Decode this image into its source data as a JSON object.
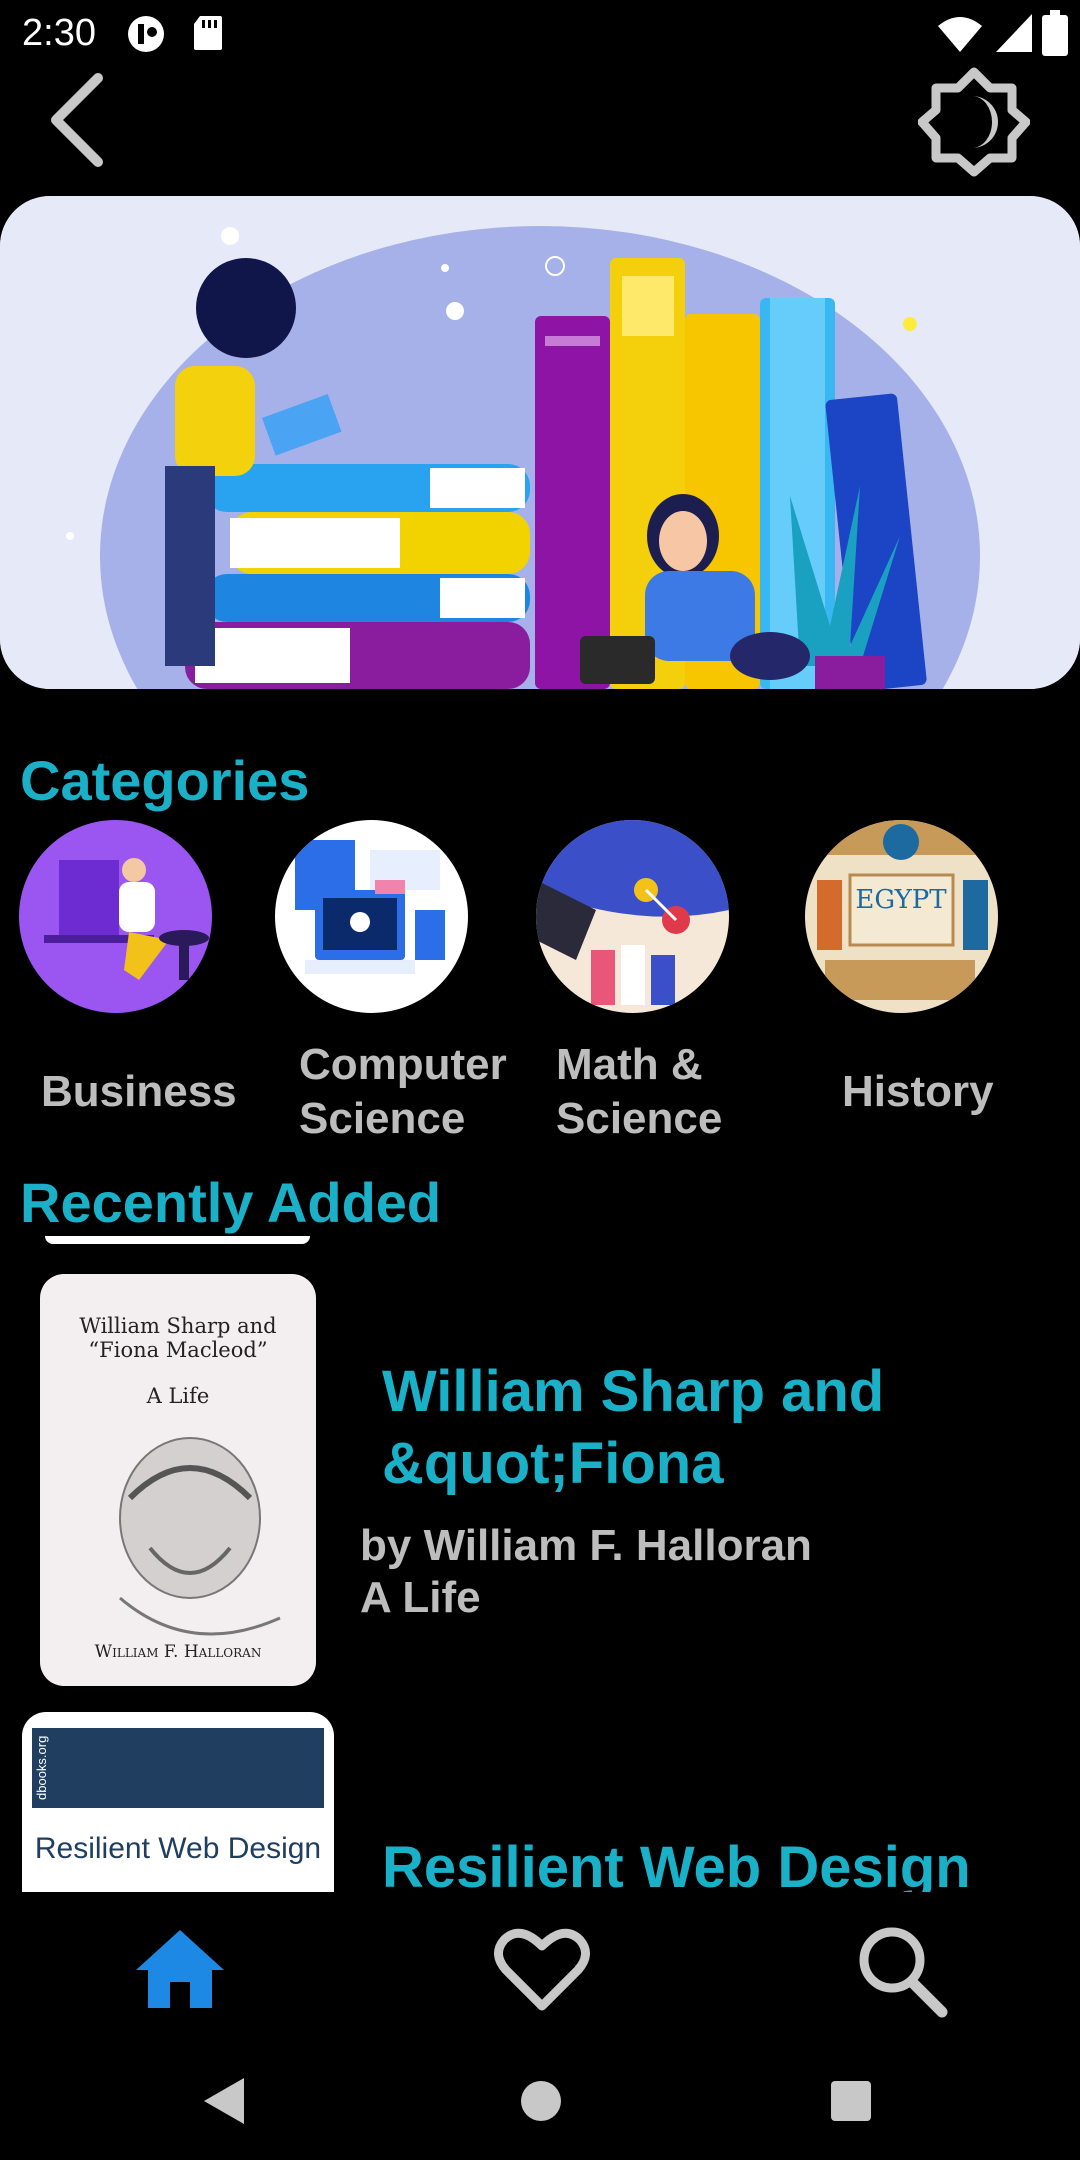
{
  "status": {
    "time": "2:30"
  },
  "sections": {
    "categories_title": "Categories",
    "recent_title": "Recently Added"
  },
  "categories": [
    {
      "label_line1": "Business",
      "label_line2": ""
    },
    {
      "label_line1": "Computer",
      "label_line2": "Science"
    },
    {
      "label_line1": "Math &",
      "label_line2": "Science"
    },
    {
      "label_line1": "History",
      "label_line2": ""
    }
  ],
  "books": [
    {
      "title_line1": "William Sharp and",
      "title_line2": "&quot;Fiona",
      "author": "by William F. Halloran",
      "subtitle": "A Life",
      "cover": {
        "line1": "William Sharp and",
        "line2": "“Fiona Macleod”",
        "line3": "A Life",
        "author": "William F. Halloran"
      }
    },
    {
      "title_line1": "Resilient Web Design",
      "cover": {
        "site": "dbooks.org",
        "title": "Resilient Web Design"
      }
    }
  ],
  "hero": {
    "egypt_text": "EGYPT"
  },
  "colors": {
    "accent": "#1ab0c8",
    "nav_active": "#1e88e5",
    "muted": "#bdbdbd"
  },
  "nav": {
    "items": [
      {
        "icon": "home-icon",
        "active": true
      },
      {
        "icon": "heart-icon",
        "active": false
      },
      {
        "icon": "search-icon",
        "active": false
      }
    ]
  }
}
